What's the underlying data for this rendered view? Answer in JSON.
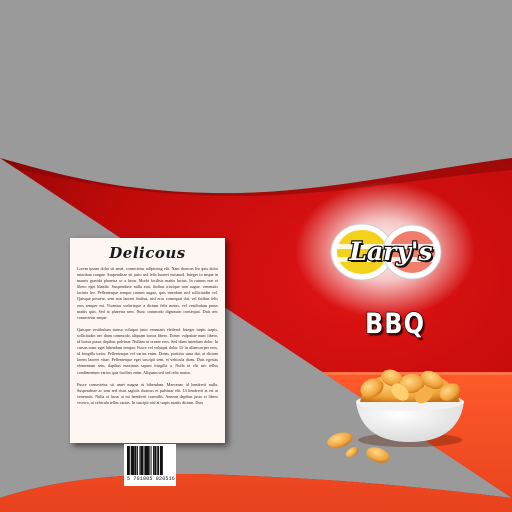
{
  "brand": {
    "name": "Lary's",
    "flavor": "BBQ"
  },
  "back_panel": {
    "title": "Delicous",
    "paragraphs": [
      "Lorem ipsum dolor sit amet, consectetur adipiscing elit. Nam rhoncus leo quis dolor interdum congue. Suspendisse sit justo sed felis laoreet euismod. Integer in neque in mauris gravida pharetra ac a lacus. Morbi facilisis mattis luctus. In rutrum erat et libero eget blandit. Suspendisse nulla erat, finibus tristique non augue, venenatis lacinia leo. Pellentesque tempor rutrum augue, quis interdum nisl sollicitudin vel. Quisque posuere, sem non laoreet finibus, nisl eros consequat dui, vel finibus felis eros semper mi. Vivamus scelerisque a dictum felis metus, vel vestibulum purus mattis quis. Sed at pharetra sem. Nunc commodo dignissim consequat. Duis nec consectetur neque.",
      "Quisque vestibulum massa volutpat justo venenatis eleifend. Integer turpis turpis, sollicitudin nec diam commodo, aliquam luctus libero. Donec vulputate nunc libero, id luctus purus dapibus pulvinar. Nullam ut ornare eros. Sed diam interdum dolor. In cursus nunc eget bibendum tempor. Fusce vel volutpat dolor. Ut in ullamcorper eros, id fringilla tortor. Pellentesque vel varius enim. Donec porttitor urna dui, at dictum lorem laoreet vitae. Pellentesque eget suscipit sem, et vehicula diam. Duis egestas elementum sem, dapibus maximus sapien fringilla a. Nulla in elit nec tellus condimentum varius quis facilisis enim. Aliquam sed sed odio massa.",
      "Fusce consectetur sit amet magna ut bibendum. Maecenas id hendrerit nulla. Suspendisse ac sem sed risus sagittis rhoncus et pulvinar elit. Ut hendrerit at est at venenatis. Nulla at lacus at mi hendrerit convallis. Aenean dapibus justo et libero viverra, ut vehicula tellus varius. In suscipit nisl at turpis mattis dictum. Duis"
    ]
  },
  "barcode": {
    "digits": "5 701005 020516"
  },
  "colors": {
    "background": "#9a9a9a",
    "bag_red": "#c00a0a",
    "bag_dark_red": "#7a0505",
    "bag_orange": "#f0502a",
    "panel": "#fdf6f2",
    "logo_yellow": "#f4d11a",
    "logo_salmon": "#f17e6c"
  }
}
